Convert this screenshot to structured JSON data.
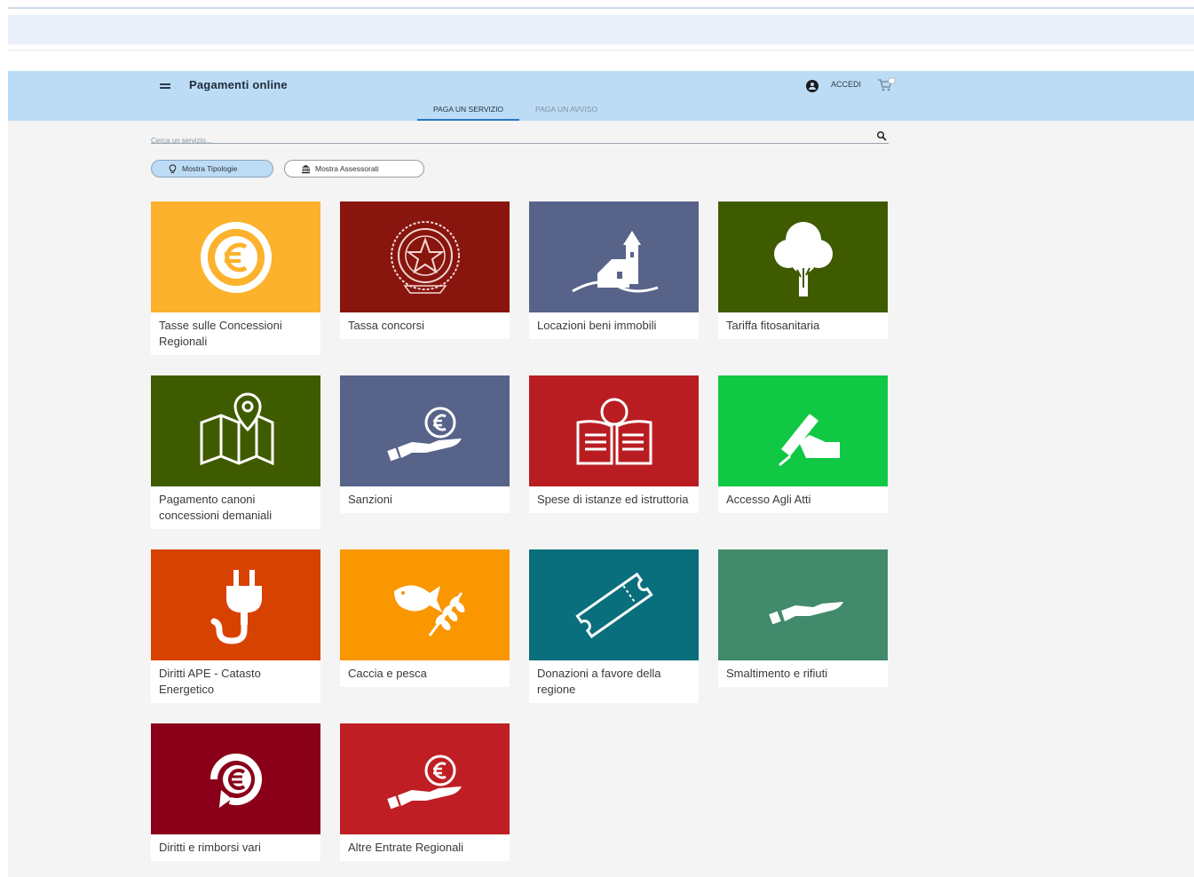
{
  "header": {
    "title": "Pagamenti online",
    "login_label": "ACCEDI",
    "bg_color": "#bcdcf6"
  },
  "tabs": [
    {
      "label": "PAGA UN SERVIZIO",
      "active": true
    },
    {
      "label": "PAGA UN AVVISO",
      "active": false
    }
  ],
  "search": {
    "placeholder": "Cerca un servizio..."
  },
  "filters": [
    {
      "label": "Mostra Tipologie",
      "icon": "lightbulb-icon",
      "active": true
    },
    {
      "label": "Mostra Assessorati",
      "icon": "bank-building-icon",
      "active": false
    }
  ],
  "services": [
    {
      "label": "Tasse sulle Concessioni Regionali",
      "color": "#fcb22c",
      "icon": "euro-coin-icon"
    },
    {
      "label": "Tassa concorsi",
      "color": "#88150e",
      "icon": "republic-emblem-icon"
    },
    {
      "label": "Locazioni beni immobili",
      "color": "#58638a",
      "icon": "rural-house-icon"
    },
    {
      "label": "Tariffa fitosanitaria",
      "color": "#3f5b00",
      "icon": "tree-icon"
    },
    {
      "label": "Pagamento canoni concessioni demaniali",
      "color": "#3f5b00",
      "icon": "map-pin-icon"
    },
    {
      "label": "Sanzioni",
      "color": "#58638a",
      "icon": "hand-euro-icon"
    },
    {
      "label": "Spese di istanze ed istruttoria",
      "color": "#b91d22",
      "icon": "open-book-icon"
    },
    {
      "label": "Accesso Agli Atti",
      "color": "#10c844",
      "icon": "hand-writing-icon"
    },
    {
      "label": "Diritti APE - Catasto Energetico",
      "color": "#d84200",
      "icon": "power-plug-icon"
    },
    {
      "label": "Caccia e pesca",
      "color": "#fa9600",
      "icon": "fish-wheat-icon"
    },
    {
      "label": "Donazioni a favore della regione",
      "color": "#0a6f7c",
      "icon": "ticket-icon"
    },
    {
      "label": "Smaltimento e rifiuti",
      "color": "#418a6c",
      "icon": "open-hand-icon"
    },
    {
      "label": "Diritti e rimborsi vari",
      "color": "#8a0019",
      "icon": "euro-refresh-icon"
    },
    {
      "label": "Altre Entrate Regionali",
      "color": "#bf1e24",
      "icon": "hand-euro-icon"
    }
  ]
}
